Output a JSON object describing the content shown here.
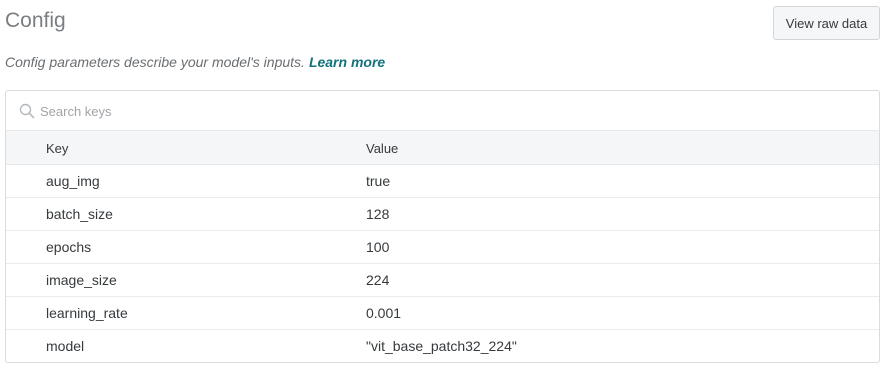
{
  "header": {
    "title": "Config",
    "raw_button_label": "View raw data"
  },
  "description": {
    "text": "Config parameters describe your model's inputs.",
    "link_label": "Learn more"
  },
  "search": {
    "placeholder": "Search keys",
    "icon": "search-icon"
  },
  "table": {
    "columns": {
      "key": "Key",
      "value": "Value"
    },
    "rows": [
      {
        "key": "aug_img",
        "value": "true"
      },
      {
        "key": "batch_size",
        "value": "128"
      },
      {
        "key": "epochs",
        "value": "100"
      },
      {
        "key": "image_size",
        "value": "224"
      },
      {
        "key": "learning_rate",
        "value": "0.001"
      },
      {
        "key": "model",
        "value": "\"vit_base_patch32_224\""
      }
    ]
  },
  "colors": {
    "link": "#13737d",
    "title": "#7a7e82",
    "text": "#363a3d"
  }
}
